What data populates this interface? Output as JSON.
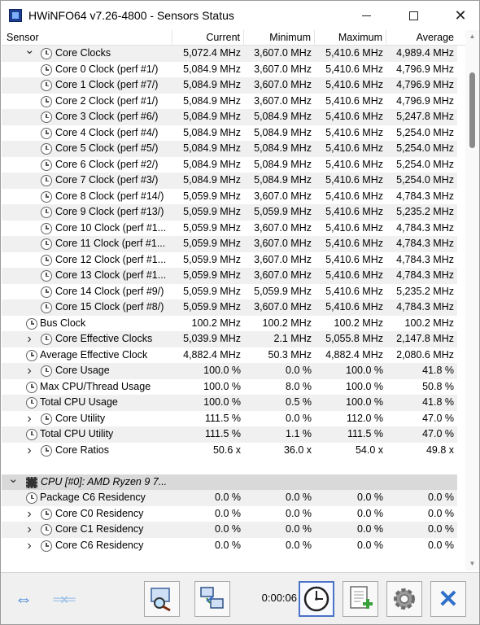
{
  "window": {
    "title": "HWiNFO64 v7.26-4800 - Sensors Status"
  },
  "columns": {
    "sensor": "Sensor",
    "current": "Current",
    "minimum": "Minimum",
    "maximum": "Maximum",
    "average": "Average"
  },
  "rows": [
    {
      "indent": 1,
      "chev": "down",
      "icon": "clock",
      "name": "Core Clocks",
      "cur": "5,072.4 MHz",
      "min": "3,607.0 MHz",
      "max": "5,410.6 MHz",
      "avg": "4,989.4 MHz"
    },
    {
      "indent": 2,
      "chev": "",
      "icon": "clock",
      "name": "Core 0 Clock (perf #1/)",
      "cur": "5,084.9 MHz",
      "min": "3,607.0 MHz",
      "max": "5,410.6 MHz",
      "avg": "4,796.9 MHz"
    },
    {
      "indent": 2,
      "chev": "",
      "icon": "clock",
      "name": "Core 1 Clock (perf #7/)",
      "cur": "5,084.9 MHz",
      "min": "3,607.0 MHz",
      "max": "5,410.6 MHz",
      "avg": "4,796.9 MHz"
    },
    {
      "indent": 2,
      "chev": "",
      "icon": "clock",
      "name": "Core 2 Clock (perf #1/)",
      "cur": "5,084.9 MHz",
      "min": "3,607.0 MHz",
      "max": "5,410.6 MHz",
      "avg": "4,796.9 MHz"
    },
    {
      "indent": 2,
      "chev": "",
      "icon": "clock",
      "name": "Core 3 Clock (perf #6/)",
      "cur": "5,084.9 MHz",
      "min": "5,084.9 MHz",
      "max": "5,410.6 MHz",
      "avg": "5,247.8 MHz"
    },
    {
      "indent": 2,
      "chev": "",
      "icon": "clock",
      "name": "Core 4 Clock (perf #4/)",
      "cur": "5,084.9 MHz",
      "min": "5,084.9 MHz",
      "max": "5,410.6 MHz",
      "avg": "5,254.0 MHz"
    },
    {
      "indent": 2,
      "chev": "",
      "icon": "clock",
      "name": "Core 5 Clock (perf #5/)",
      "cur": "5,084.9 MHz",
      "min": "5,084.9 MHz",
      "max": "5,410.6 MHz",
      "avg": "5,254.0 MHz"
    },
    {
      "indent": 2,
      "chev": "",
      "icon": "clock",
      "name": "Core 6 Clock (perf #2/)",
      "cur": "5,084.9 MHz",
      "min": "5,084.9 MHz",
      "max": "5,410.6 MHz",
      "avg": "5,254.0 MHz"
    },
    {
      "indent": 2,
      "chev": "",
      "icon": "clock",
      "name": "Core 7 Clock (perf #3/)",
      "cur": "5,084.9 MHz",
      "min": "5,084.9 MHz",
      "max": "5,410.6 MHz",
      "avg": "5,254.0 MHz"
    },
    {
      "indent": 2,
      "chev": "",
      "icon": "clock",
      "name": "Core 8 Clock (perf #14/)",
      "cur": "5,059.9 MHz",
      "min": "3,607.0 MHz",
      "max": "5,410.6 MHz",
      "avg": "4,784.3 MHz"
    },
    {
      "indent": 2,
      "chev": "",
      "icon": "clock",
      "name": "Core 9 Clock (perf #13/)",
      "cur": "5,059.9 MHz",
      "min": "5,059.9 MHz",
      "max": "5,410.6 MHz",
      "avg": "5,235.2 MHz"
    },
    {
      "indent": 2,
      "chev": "",
      "icon": "clock",
      "name": "Core 10 Clock (perf #1...",
      "cur": "5,059.9 MHz",
      "min": "3,607.0 MHz",
      "max": "5,410.6 MHz",
      "avg": "4,784.3 MHz"
    },
    {
      "indent": 2,
      "chev": "",
      "icon": "clock",
      "name": "Core 11 Clock (perf #1...",
      "cur": "5,059.9 MHz",
      "min": "3,607.0 MHz",
      "max": "5,410.6 MHz",
      "avg": "4,784.3 MHz"
    },
    {
      "indent": 2,
      "chev": "",
      "icon": "clock",
      "name": "Core 12 Clock (perf #1...",
      "cur": "5,059.9 MHz",
      "min": "3,607.0 MHz",
      "max": "5,410.6 MHz",
      "avg": "4,784.3 MHz"
    },
    {
      "indent": 2,
      "chev": "",
      "icon": "clock",
      "name": "Core 13 Clock (perf #1...",
      "cur": "5,059.9 MHz",
      "min": "3,607.0 MHz",
      "max": "5,410.6 MHz",
      "avg": "4,784.3 MHz"
    },
    {
      "indent": 2,
      "chev": "",
      "icon": "clock",
      "name": "Core 14 Clock (perf #9/)",
      "cur": "5,059.9 MHz",
      "min": "5,059.9 MHz",
      "max": "5,410.6 MHz",
      "avg": "5,235.2 MHz"
    },
    {
      "indent": 2,
      "chev": "",
      "icon": "clock",
      "name": "Core 15 Clock (perf #8/)",
      "cur": "5,059.9 MHz",
      "min": "3,607.0 MHz",
      "max": "5,410.6 MHz",
      "avg": "4,784.3 MHz"
    },
    {
      "indent": 0,
      "chev": "",
      "icon": "clock",
      "name": "Bus Clock",
      "cur": "100.2 MHz",
      "min": "100.2 MHz",
      "max": "100.2 MHz",
      "avg": "100.2 MHz"
    },
    {
      "indent": 1,
      "chev": "right",
      "icon": "clock",
      "name": "Core Effective Clocks",
      "cur": "5,039.9 MHz",
      "min": "2.1 MHz",
      "max": "5,055.8 MHz",
      "avg": "2,147.8 MHz"
    },
    {
      "indent": 0,
      "chev": "",
      "icon": "clock",
      "name": "Average Effective Clock",
      "cur": "4,882.4 MHz",
      "min": "50.3 MHz",
      "max": "4,882.4 MHz",
      "avg": "2,080.6 MHz"
    },
    {
      "indent": 1,
      "chev": "right",
      "icon": "clock",
      "name": "Core Usage",
      "cur": "100.0 %",
      "min": "0.0 %",
      "max": "100.0 %",
      "avg": "41.8 %"
    },
    {
      "indent": 0,
      "chev": "",
      "icon": "clock",
      "name": "Max CPU/Thread Usage",
      "cur": "100.0 %",
      "min": "8.0 %",
      "max": "100.0 %",
      "avg": "50.8 %"
    },
    {
      "indent": 0,
      "chev": "",
      "icon": "clock",
      "name": "Total CPU Usage",
      "cur": "100.0 %",
      "min": "0.5 %",
      "max": "100.0 %",
      "avg": "41.8 %"
    },
    {
      "indent": 1,
      "chev": "right",
      "icon": "clock",
      "name": "Core Utility",
      "cur": "111.5 %",
      "min": "0.0 %",
      "max": "112.0 %",
      "avg": "47.0 %"
    },
    {
      "indent": 0,
      "chev": "",
      "icon": "clock",
      "name": "Total CPU Utility",
      "cur": "111.5 %",
      "min": "1.1 %",
      "max": "111.5 %",
      "avg": "47.0 %"
    },
    {
      "indent": 1,
      "chev": "right",
      "icon": "clock",
      "name": "Core Ratios",
      "cur": "50.6 x",
      "min": "36.0 x",
      "max": "54.0 x",
      "avg": "49.8 x"
    },
    {
      "indent": -1,
      "chev": "",
      "icon": "",
      "name": "",
      "cur": "",
      "min": "",
      "max": "",
      "avg": ""
    },
    {
      "indent": -2,
      "chev": "down",
      "icon": "cpu",
      "name": "CPU [#0]: AMD Ryzen 9 7...",
      "cur": "",
      "min": "",
      "max": "",
      "avg": ""
    },
    {
      "indent": 0,
      "chev": "",
      "icon": "clock",
      "name": "Package C6 Residency",
      "cur": "0.0 %",
      "min": "0.0 %",
      "max": "0.0 %",
      "avg": "0.0 %"
    },
    {
      "indent": 1,
      "chev": "right",
      "icon": "clock",
      "name": "Core C0 Residency",
      "cur": "0.0 %",
      "min": "0.0 %",
      "max": "0.0 %",
      "avg": "0.0 %"
    },
    {
      "indent": 1,
      "chev": "right",
      "icon": "clock",
      "name": "Core C1 Residency",
      "cur": "0.0 %",
      "min": "0.0 %",
      "max": "0.0 %",
      "avg": "0.0 %"
    },
    {
      "indent": 1,
      "chev": "right",
      "icon": "clock",
      "name": "Core C6 Residency",
      "cur": "0.0 %",
      "min": "0.0 %",
      "max": "0.0 %",
      "avg": "0.0 %"
    }
  ],
  "toolbar": {
    "timer": "0:00:06"
  }
}
